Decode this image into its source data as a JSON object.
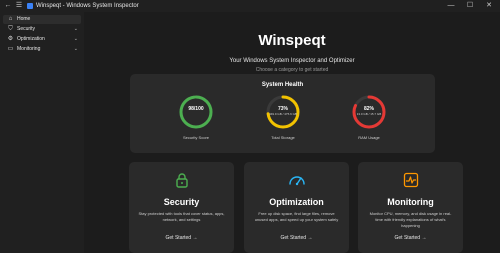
{
  "window": {
    "title": "Winspeqt - Windows System Inspector",
    "back_icon": "←",
    "menu_icon": "☰",
    "minimize_icon": "—",
    "maximize_icon": "☐",
    "close_icon": "✕"
  },
  "sidebar": {
    "items": [
      {
        "label": "Home",
        "icon": "⌂",
        "active": true
      },
      {
        "label": "Security",
        "icon": "⛉",
        "chevron": "⌄"
      },
      {
        "label": "Optimization",
        "icon": "⚙",
        "chevron": "⌄"
      },
      {
        "label": "Monitoring",
        "icon": "▭",
        "chevron": "⌄"
      }
    ]
  },
  "hero": {
    "title": "Winspeqt",
    "subtitle": "Your Windows System Inspector and Optimizer",
    "hint": "Choose a category to get started"
  },
  "health": {
    "title": "System Health",
    "gauges": [
      {
        "value": "98/100",
        "fraction": 0.98,
        "detail": "",
        "label": "Security Score",
        "color": "#4caf50"
      },
      {
        "value": "73%",
        "fraction": 0.73,
        "detail": "349.9 GB / 475.6 GB",
        "label": "Total Storage",
        "color": "#f2c200"
      },
      {
        "value": "82%",
        "fraction": 0.82,
        "detail": "13.0 GB / 15.7 GB",
        "label": "RAM Usage",
        "color": "#e53935"
      }
    ]
  },
  "cards": [
    {
      "title": "Security",
      "desc": "Stay protected with tools that cover status, apps, network, and settings",
      "link": "Get Started →",
      "icon": "lock-icon",
      "icon_color": "#4caf50"
    },
    {
      "title": "Optimization",
      "desc": "Free up disk space, find large files, remove unused apps, and speed up your system safely",
      "link": "Get Started →",
      "icon": "speedometer-icon",
      "icon_color": "#29b6f6"
    },
    {
      "title": "Monitoring",
      "desc": "Monitor CPU, memory, and disk usage in real-time with friendly explanations of what's happening",
      "link": "Get Started →",
      "icon": "pulse-icon",
      "icon_color": "#ff9800"
    }
  ]
}
